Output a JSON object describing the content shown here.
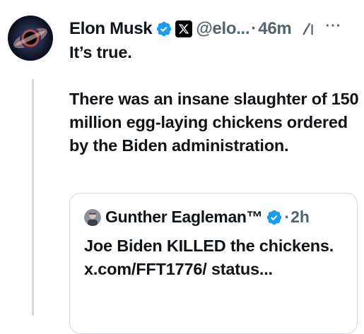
{
  "tweet": {
    "author_name": "Elon Musk",
    "author_handle": "@elo...",
    "separator": "·",
    "time_ago": "46m",
    "more_label": "···",
    "text_line1": "It’s true.",
    "text_line2": "There was an insane slaughter of 150 million egg-laying chickens ordered by the Biden administration."
  },
  "quote": {
    "author_name": "Gunther Eagleman™",
    "separator": "·",
    "time_ago": "2h",
    "text": "Joe Biden KILLED the chickens. x.com/FFT1776/ status..."
  },
  "icons": {
    "avatar": "black-hole-avatar",
    "verified": "verified-badge-icon",
    "x_badge": "x-logo-icon",
    "grok": "grok-icon",
    "more": "more-icon",
    "quote_avatar": "quote-author-avatar"
  },
  "colors": {
    "text_primary": "#0f1419",
    "text_secondary": "#536471",
    "verified_blue": "#1d9bf0",
    "border": "#cfd9de"
  }
}
